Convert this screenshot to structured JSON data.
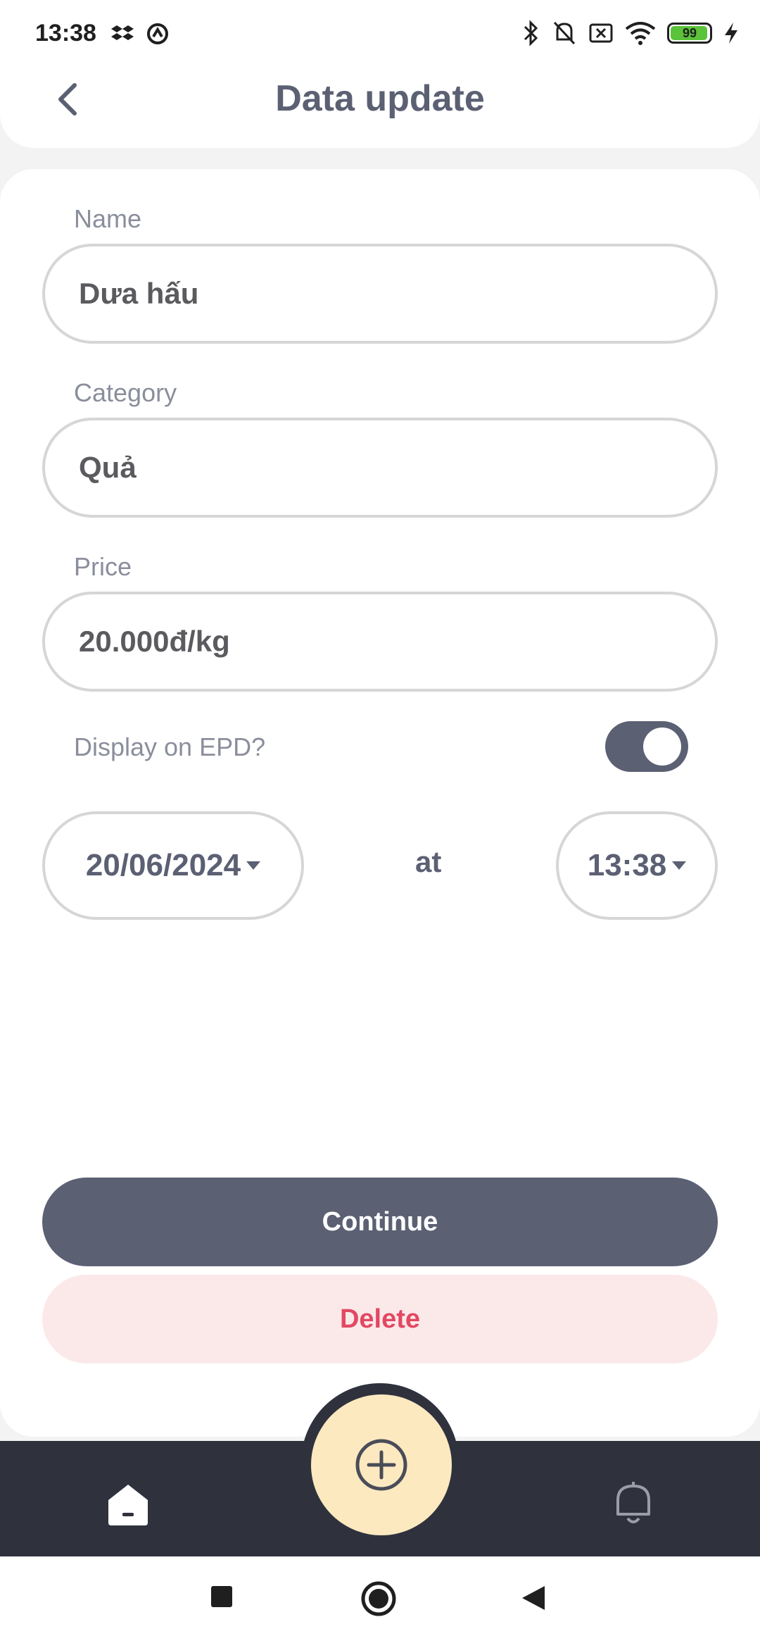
{
  "status_bar": {
    "time": "13:38",
    "battery": "99",
    "icons_left": [
      "dropbox-icon",
      "sync-icon"
    ],
    "icons_right": [
      "bluetooth-icon",
      "bell-off-icon",
      "sim-off-icon",
      "wifi-icon",
      "battery-icon",
      "charging-icon"
    ]
  },
  "header": {
    "title": "Data update",
    "back_icon": "chevron-left-icon"
  },
  "form": {
    "name": {
      "label": "Name",
      "value": "Dưa hấu"
    },
    "category": {
      "label": "Category",
      "value": "Quả"
    },
    "price": {
      "label": "Price",
      "value": "20.000đ/kg"
    },
    "display_on_epd": {
      "label": "Display on EPD?",
      "enabled": true
    },
    "date": "20/06/2024",
    "at_label": "at",
    "time": "13:38"
  },
  "actions": {
    "continue": "Continue",
    "delete": "Delete"
  },
  "bottom_nav": {
    "items": [
      "home-icon",
      "add-circle-icon",
      "bell-icon"
    ]
  },
  "system_nav": {
    "items": [
      "recent-apps-icon",
      "home-circle-icon",
      "back-triangle-icon"
    ]
  },
  "colors": {
    "primary": "#5b6073",
    "delete_text": "#e24862",
    "delete_bg": "#fbe9ea",
    "fab": "#fde9c0",
    "nav_bg": "#2f323d"
  }
}
